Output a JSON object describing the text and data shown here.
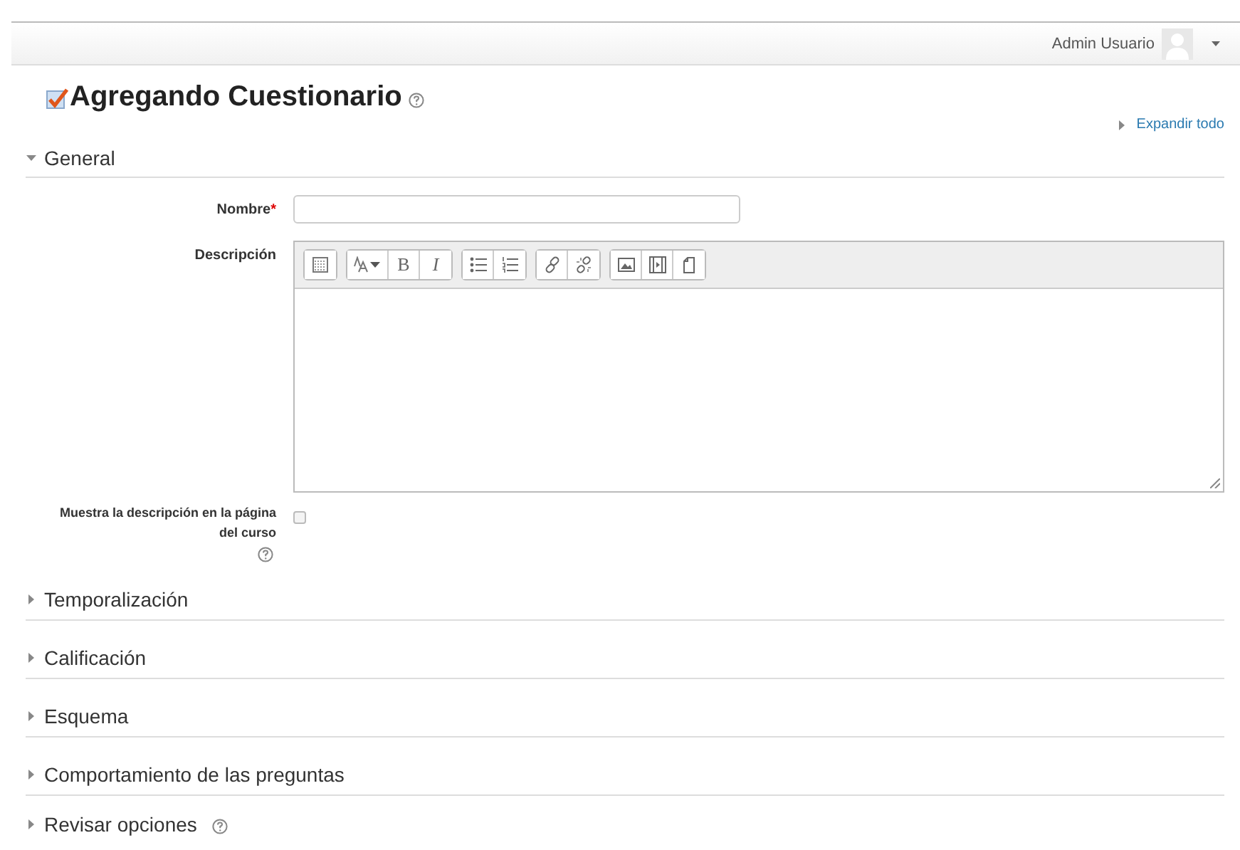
{
  "header": {
    "user_name": "Admin Usuario"
  },
  "page_title": "Agregando Cuestionario",
  "expand_all": "Expandir todo",
  "general": {
    "title": "General",
    "expanded": true,
    "name_field": {
      "label": "Nombre",
      "required_mark": "*"
    },
    "description": {
      "label": "Descripción",
      "toolbar": [
        [
          {
            "kind": "fullscreen"
          }
        ],
        [
          {
            "kind": "font"
          },
          {
            "kind": "bold",
            "label": "B"
          },
          {
            "kind": "italic",
            "label": "I"
          }
        ],
        [
          {
            "kind": "bullets"
          },
          {
            "kind": "numbers"
          }
        ],
        [
          {
            "kind": "link"
          },
          {
            "kind": "unlink"
          }
        ],
        [
          {
            "kind": "image"
          },
          {
            "kind": "media"
          },
          {
            "kind": "files"
          }
        ]
      ]
    },
    "show_description": {
      "label": "Muestra la descripción en la página del curso",
      "checked": false
    }
  },
  "sections": [
    {
      "title": "Temporalización",
      "expanded": false,
      "help": false
    },
    {
      "title": "Calificación",
      "expanded": false,
      "help": false
    },
    {
      "title": "Esquema",
      "expanded": false,
      "help": false
    },
    {
      "title": "Comportamiento de las preguntas",
      "expanded": false,
      "help": false
    },
    {
      "title": "Revisar opciones",
      "expanded": false,
      "help": true
    }
  ]
}
